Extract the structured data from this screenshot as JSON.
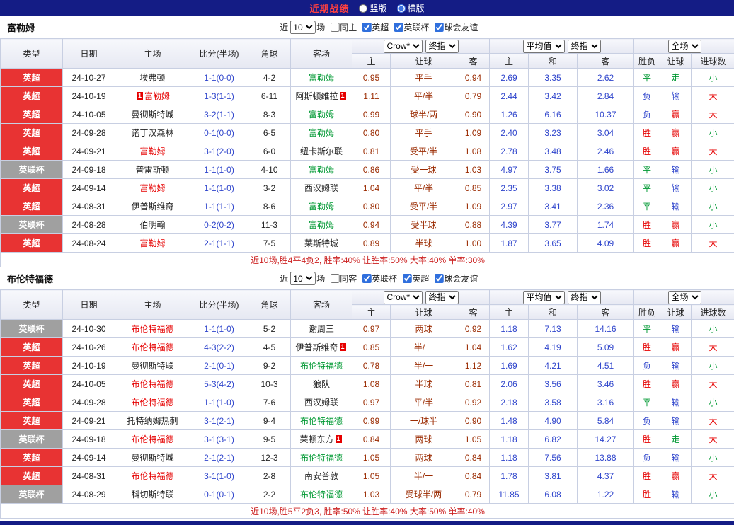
{
  "header": {
    "title": "近期战绩",
    "layout_options": [
      {
        "label": "竖版",
        "selected": false
      },
      {
        "label": "横版",
        "selected": true
      }
    ]
  },
  "table_headers": {
    "main": [
      "类型",
      "日期",
      "主场",
      "比分(半场)",
      "角球",
      "客场"
    ],
    "odds_sub": [
      "主",
      "让球",
      "客"
    ],
    "avg_sub": [
      "主",
      "和",
      "客"
    ],
    "result_sub": [
      "胜负",
      "让球",
      "进球数"
    ]
  },
  "controls": {
    "company_select": "Crow*",
    "odds_type_select": "终指",
    "avg_select": "平均值",
    "avg_type_select": "终指",
    "scope_select": "全场"
  },
  "sections": [
    {
      "team": "富勒姆",
      "filter": {
        "prefix": "近",
        "count": "10",
        "suffix": "场",
        "checkboxes": [
          {
            "label": "同主",
            "checked": false
          },
          {
            "label": "英超",
            "checked": true
          },
          {
            "label": "英联杯",
            "checked": true
          },
          {
            "label": "球会友谊",
            "checked": true
          }
        ]
      },
      "rows": [
        {
          "league": "英超",
          "date": "24-10-27",
          "home": "埃弗顿",
          "home_focal": false,
          "home_badge": "",
          "score": "1-1(0-0)",
          "corners": "4-2",
          "away": "富勒姆",
          "away_focal": true,
          "away_badge": "",
          "odds": [
            "0.95",
            "平手",
            "0.94"
          ],
          "avg": [
            "2.69",
            "3.35",
            "2.62"
          ],
          "result": "平",
          "handicap": "走",
          "goals": "小"
        },
        {
          "league": "英超",
          "date": "24-10-19",
          "home": "富勒姆",
          "home_focal": true,
          "home_badge": "1",
          "score": "1-3(1-1)",
          "corners": "6-11",
          "away": "阿斯顿维拉",
          "away_focal": false,
          "away_badge": "1",
          "odds": [
            "1.11",
            "平/半",
            "0.79"
          ],
          "avg": [
            "2.44",
            "3.42",
            "2.84"
          ],
          "result": "负",
          "handicap": "输",
          "goals": "大"
        },
        {
          "league": "英超",
          "date": "24-10-05",
          "home": "曼彻斯特城",
          "home_focal": false,
          "home_badge": "",
          "score": "3-2(1-1)",
          "corners": "8-3",
          "away": "富勒姆",
          "away_focal": true,
          "away_badge": "",
          "odds": [
            "0.99",
            "球半/两",
            "0.90"
          ],
          "avg": [
            "1.26",
            "6.16",
            "10.37"
          ],
          "result": "负",
          "handicap": "赢",
          "goals": "大"
        },
        {
          "league": "英超",
          "date": "24-09-28",
          "home": "诺丁汉森林",
          "home_focal": false,
          "home_badge": "",
          "score": "0-1(0-0)",
          "corners": "6-5",
          "away": "富勒姆",
          "away_focal": true,
          "away_badge": "",
          "odds": [
            "0.80",
            "平手",
            "1.09"
          ],
          "avg": [
            "2.40",
            "3.23",
            "3.04"
          ],
          "result": "胜",
          "handicap": "赢",
          "goals": "小"
        },
        {
          "league": "英超",
          "date": "24-09-21",
          "home": "富勒姆",
          "home_focal": true,
          "home_badge": "",
          "score": "3-1(2-0)",
          "corners": "6-0",
          "away": "纽卡斯尔联",
          "away_focal": false,
          "away_badge": "",
          "odds": [
            "0.81",
            "受平/半",
            "1.08"
          ],
          "avg": [
            "2.78",
            "3.48",
            "2.46"
          ],
          "result": "胜",
          "handicap": "赢",
          "goals": "大"
        },
        {
          "league": "英联杯",
          "date": "24-09-18",
          "home": "普雷斯顿",
          "home_focal": false,
          "home_badge": "",
          "score": "1-1(1-0)",
          "corners": "4-10",
          "away": "富勒姆",
          "away_focal": true,
          "away_badge": "",
          "odds": [
            "0.86",
            "受一球",
            "1.03"
          ],
          "avg": [
            "4.97",
            "3.75",
            "1.66"
          ],
          "result": "平",
          "handicap": "输",
          "goals": "小"
        },
        {
          "league": "英超",
          "date": "24-09-14",
          "home": "富勒姆",
          "home_focal": true,
          "home_badge": "",
          "score": "1-1(1-0)",
          "corners": "3-2",
          "away": "西汉姆联",
          "away_focal": false,
          "away_badge": "",
          "odds": [
            "1.04",
            "平/半",
            "0.85"
          ],
          "avg": [
            "2.35",
            "3.38",
            "3.02"
          ],
          "result": "平",
          "handicap": "输",
          "goals": "小"
        },
        {
          "league": "英超",
          "date": "24-08-31",
          "home": "伊普斯维奇",
          "home_focal": false,
          "home_badge": "",
          "score": "1-1(1-1)",
          "corners": "8-6",
          "away": "富勒姆",
          "away_focal": true,
          "away_badge": "",
          "odds": [
            "0.80",
            "受平/半",
            "1.09"
          ],
          "avg": [
            "2.97",
            "3.41",
            "2.36"
          ],
          "result": "平",
          "handicap": "输",
          "goals": "小"
        },
        {
          "league": "英联杯",
          "date": "24-08-28",
          "home": "伯明翰",
          "home_focal": false,
          "home_badge": "",
          "score": "0-2(0-2)",
          "corners": "11-3",
          "away": "富勒姆",
          "away_focal": true,
          "away_badge": "",
          "odds": [
            "0.94",
            "受半球",
            "0.88"
          ],
          "avg": [
            "4.39",
            "3.77",
            "1.74"
          ],
          "result": "胜",
          "handicap": "赢",
          "goals": "小"
        },
        {
          "league": "英超",
          "date": "24-08-24",
          "home": "富勒姆",
          "home_focal": true,
          "home_badge": "",
          "score": "2-1(1-1)",
          "corners": "7-5",
          "away": "莱斯特城",
          "away_focal": false,
          "away_badge": "",
          "odds": [
            "0.89",
            "半球",
            "1.00"
          ],
          "avg": [
            "1.87",
            "3.65",
            "4.09"
          ],
          "result": "胜",
          "handicap": "赢",
          "goals": "大"
        }
      ],
      "summary": "近10场,胜4平4负2, 胜率:40% 让胜率:50% 大率:40% 单率:30%"
    },
    {
      "team": "布伦特福德",
      "filter": {
        "prefix": "近",
        "count": "10",
        "suffix": "场",
        "checkboxes": [
          {
            "label": "同客",
            "checked": false
          },
          {
            "label": "英联杯",
            "checked": true
          },
          {
            "label": "英超",
            "checked": true
          },
          {
            "label": "球会友谊",
            "checked": true
          }
        ]
      },
      "rows": [
        {
          "league": "英联杯",
          "date": "24-10-30",
          "home": "布伦特福德",
          "home_focal": true,
          "home_badge": "",
          "score": "1-1(1-0)",
          "corners": "5-2",
          "away": "谢周三",
          "away_focal": false,
          "away_badge": "",
          "odds": [
            "0.97",
            "两球",
            "0.92"
          ],
          "avg": [
            "1.18",
            "7.13",
            "14.16"
          ],
          "result": "平",
          "handicap": "输",
          "goals": "小"
        },
        {
          "league": "英超",
          "date": "24-10-26",
          "home": "布伦特福德",
          "home_focal": true,
          "home_badge": "",
          "score": "4-3(2-2)",
          "corners": "4-5",
          "away": "伊普斯维奇",
          "away_focal": false,
          "away_badge": "1",
          "odds": [
            "0.85",
            "半/一",
            "1.04"
          ],
          "avg": [
            "1.62",
            "4.19",
            "5.09"
          ],
          "result": "胜",
          "handicap": "赢",
          "goals": "大"
        },
        {
          "league": "英超",
          "date": "24-10-19",
          "home": "曼彻斯特联",
          "home_focal": false,
          "home_badge": "",
          "score": "2-1(0-1)",
          "corners": "9-2",
          "away": "布伦特福德",
          "away_focal": true,
          "away_badge": "",
          "odds": [
            "0.78",
            "半/一",
            "1.12"
          ],
          "avg": [
            "1.69",
            "4.21",
            "4.51"
          ],
          "result": "负",
          "handicap": "输",
          "goals": "小"
        },
        {
          "league": "英超",
          "date": "24-10-05",
          "home": "布伦特福德",
          "home_focal": true,
          "home_badge": "",
          "score": "5-3(4-2)",
          "corners": "10-3",
          "away": "狼队",
          "away_focal": false,
          "away_badge": "",
          "odds": [
            "1.08",
            "半球",
            "0.81"
          ],
          "avg": [
            "2.06",
            "3.56",
            "3.46"
          ],
          "result": "胜",
          "handicap": "赢",
          "goals": "大"
        },
        {
          "league": "英超",
          "date": "24-09-28",
          "home": "布伦特福德",
          "home_focal": true,
          "home_badge": "",
          "score": "1-1(1-0)",
          "corners": "7-6",
          "away": "西汉姆联",
          "away_focal": false,
          "away_badge": "",
          "odds": [
            "0.97",
            "平/半",
            "0.92"
          ],
          "avg": [
            "2.18",
            "3.58",
            "3.16"
          ],
          "result": "平",
          "handicap": "输",
          "goals": "小"
        },
        {
          "league": "英超",
          "date": "24-09-21",
          "home": "托特纳姆热刺",
          "home_focal": false,
          "home_badge": "",
          "score": "3-1(2-1)",
          "corners": "9-4",
          "away": "布伦特福德",
          "away_focal": true,
          "away_badge": "",
          "odds": [
            "0.99",
            "一/球半",
            "0.90"
          ],
          "avg": [
            "1.48",
            "4.90",
            "5.84"
          ],
          "result": "负",
          "handicap": "输",
          "goals": "大"
        },
        {
          "league": "英联杯",
          "date": "24-09-18",
          "home": "布伦特福德",
          "home_focal": true,
          "home_badge": "",
          "score": "3-1(3-1)",
          "corners": "9-5",
          "away": "莱顿东方",
          "away_focal": false,
          "away_badge": "1",
          "odds": [
            "0.84",
            "两球",
            "1.05"
          ],
          "avg": [
            "1.18",
            "6.82",
            "14.27"
          ],
          "result": "胜",
          "handicap": "走",
          "goals": "大"
        },
        {
          "league": "英超",
          "date": "24-09-14",
          "home": "曼彻斯特城",
          "home_focal": false,
          "home_badge": "",
          "score": "2-1(2-1)",
          "corners": "12-3",
          "away": "布伦特福德",
          "away_focal": true,
          "away_badge": "",
          "odds": [
            "1.05",
            "两球",
            "0.84"
          ],
          "avg": [
            "1.18",
            "7.56",
            "13.88"
          ],
          "result": "负",
          "handicap": "输",
          "goals": "小"
        },
        {
          "league": "英超",
          "date": "24-08-31",
          "home": "布伦特福德",
          "home_focal": true,
          "home_badge": "",
          "score": "3-1(1-0)",
          "corners": "2-8",
          "away": "南安普敦",
          "away_focal": false,
          "away_badge": "",
          "odds": [
            "1.05",
            "半/一",
            "0.84"
          ],
          "avg": [
            "1.78",
            "3.81",
            "4.37"
          ],
          "result": "胜",
          "handicap": "赢",
          "goals": "大"
        },
        {
          "league": "英联杯",
          "date": "24-08-29",
          "home": "科切斯特联",
          "home_focal": false,
          "home_badge": "",
          "score": "0-1(0-1)",
          "corners": "2-2",
          "away": "布伦特福德",
          "away_focal": true,
          "away_badge": "",
          "odds": [
            "1.03",
            "受球半/两",
            "0.79"
          ],
          "avg": [
            "11.85",
            "6.08",
            "1.22"
          ],
          "result": "胜",
          "handicap": "输",
          "goals": "小"
        }
      ],
      "summary": "近10场,胜5平2负3, 胜率:50% 让胜率:40% 大率:50% 单率:40%"
    }
  ],
  "colors": {
    "topbar_bg": "#141c85",
    "title_red": "#ff4040",
    "league_epl": "#e83333",
    "league_cup": "#a0a0a0",
    "result_win": "#e60000",
    "result_draw": "#009933",
    "result_lose": "#2f45cc",
    "odds_text": "#9a2a00",
    "avg_text": "#2f45cc",
    "score_text": "#2f45cc",
    "focal_home": "#e60000",
    "focal_away": "#009933",
    "summary_text": "#cc2222",
    "grid_border": "#c8cfe2",
    "header_bg": "#e6e8f2"
  }
}
